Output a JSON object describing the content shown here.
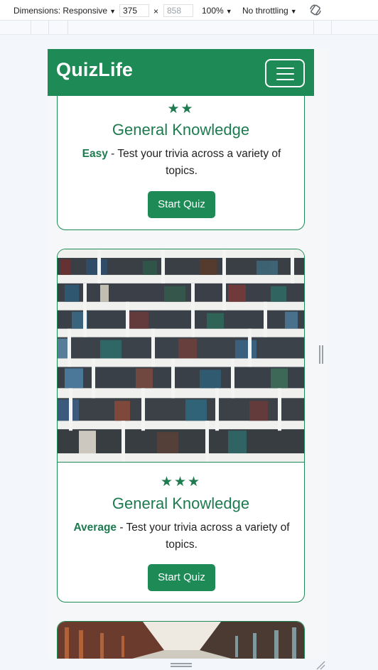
{
  "devtools": {
    "dimensions_label": "Dimensions: Responsive",
    "width": "375",
    "times": "×",
    "height": "858",
    "zoom": "100%",
    "throttling": "No throttling",
    "caret": "▼"
  },
  "navbar": {
    "brand": "QuizLife",
    "bg_color": "#1e8a55"
  },
  "quizzes": [
    {
      "stars": "★★",
      "rating": 2,
      "title": "General Knowledge",
      "level": "Easy",
      "description": " - Test your trivia across a variety of topics.",
      "button": "Start Quiz"
    },
    {
      "stars": "★★★",
      "rating": 3,
      "title": "General Knowledge",
      "level": "Average",
      "description": " - Test your trivia across a variety of topics.",
      "button": "Start Quiz",
      "image": "bookshelf-photo"
    },
    {
      "image": "library-aisle-photo"
    }
  ],
  "colors": {
    "accent": "#1e8a55",
    "title": "#1e7a4f"
  }
}
